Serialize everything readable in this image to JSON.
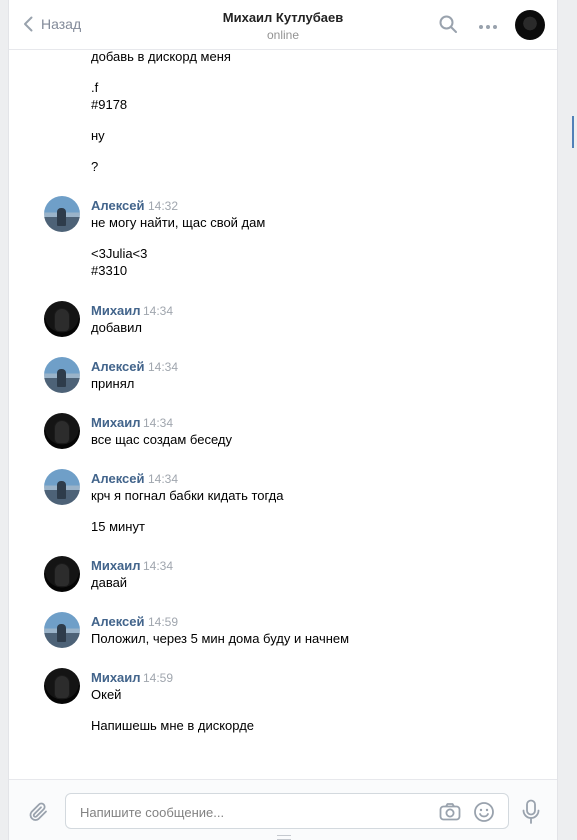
{
  "header": {
    "back_label": "Назад",
    "peer_name": "Михаил Кутлубаев",
    "peer_status": "online"
  },
  "icons": {
    "back": "chevron-left-icon",
    "search": "search-icon",
    "more": "more-dots-icon",
    "attach": "paperclip-icon",
    "camera": "camera-icon",
    "emoji": "smile-icon",
    "voice": "microphone-icon"
  },
  "colors": {
    "sender_name": "#42648b",
    "timestamp": "#a0a6ae",
    "background": "#edeef0"
  },
  "history": {
    "top_lines": [
      "добавь в дискорд меня",
      ".f",
      "#9178",
      "ну",
      "?"
    ],
    "groups": [
      {
        "sender": "Алексей",
        "avatar": "aleksey",
        "time": "14:32",
        "lines": [
          "не могу найти, щас свой дам",
          "<3Julia<3",
          "#3310"
        ]
      },
      {
        "sender": "Михаил",
        "avatar": "mikhail",
        "time": "14:34",
        "lines": [
          "добавил"
        ]
      },
      {
        "sender": "Алексей",
        "avatar": "aleksey",
        "time": "14:34",
        "lines": [
          "принял"
        ]
      },
      {
        "sender": "Михаил",
        "avatar": "mikhail",
        "time": "14:34",
        "lines": [
          "все щас создам беседу"
        ]
      },
      {
        "sender": "Алексей",
        "avatar": "aleksey",
        "time": "14:34",
        "lines": [
          "крч я погнал бабки кидать тогда",
          "15 минут"
        ]
      },
      {
        "sender": "Михаил",
        "avatar": "mikhail",
        "time": "14:34",
        "lines": [
          "давай"
        ]
      },
      {
        "sender": "Алексей",
        "avatar": "aleksey",
        "time": "14:59",
        "lines": [
          "Положил, через 5 мин дома буду и начнем"
        ]
      },
      {
        "sender": "Михаил",
        "avatar": "mikhail",
        "time": "14:59",
        "lines": [
          "Окей",
          "Напишешь мне в дискорде"
        ]
      }
    ]
  },
  "composer": {
    "placeholder": "Напишите сообщение..."
  }
}
